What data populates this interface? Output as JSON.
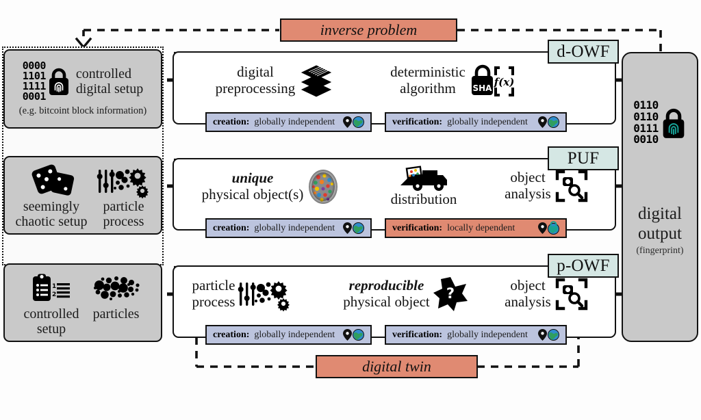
{
  "figure": {
    "title": "Digital and physical one-way function pipelines",
    "colors": {
      "red_label": "#e08a72",
      "blue_badge": "#bcc4de",
      "mint_tag": "#d5e7e4",
      "grey_box": "#c9c9c9",
      "outline": "#111111",
      "fingerprint_teal": "#17a398"
    }
  },
  "feedback": {
    "inverse_problem": "inverse problem",
    "digital_twin": "digital twin"
  },
  "tags": {
    "d_owf": "d-OWF",
    "puf": "PUF",
    "p_owf": "p-OWF"
  },
  "rows": [
    {
      "id": "d-owf",
      "setup": {
        "cells": [
          {
            "icon": "binary-lock-fingerprint-icon",
            "label": "controlled\ndigital setup",
            "line1": "controlled",
            "line2": "digital setup"
          }
        ],
        "binary": [
          "0000",
          "1101",
          "1111",
          "0001"
        ],
        "subtitle": "(e.g. bitcoint block information)"
      },
      "steps": [
        {
          "line1": "digital",
          "line2": "preprocessing",
          "icon": "layers-stack-icon",
          "italic": false
        },
        {
          "line1": "deterministic",
          "line2": "algorithm",
          "icon": "sha-lock-fx-icon",
          "italic": false
        }
      ],
      "badges": [
        {
          "kind": "creation",
          "label": "creation:",
          "value": "globally independent",
          "tone": "blue",
          "icons": [
            "pin-icon",
            "globe-icon"
          ]
        },
        {
          "kind": "verification",
          "label": "verification:",
          "value": "globally independent",
          "tone": "blue",
          "icons": [
            "pin-icon",
            "globe-icon"
          ]
        }
      ],
      "tag": "d-OWF"
    },
    {
      "id": "puf",
      "setup": {
        "cells": [
          {
            "icon": "dice-icon",
            "line1": "seemingly",
            "line2": "chaotic setup"
          },
          {
            "icon": "particle-process-icon",
            "line1": "particle",
            "line2": "process"
          }
        ],
        "subtitle": ""
      },
      "steps": [
        {
          "line1": "unique",
          "line2": "physical object(s)",
          "icon": "colorful-particle-blob-icon",
          "italic": true
        },
        {
          "line1": "",
          "line2": "distribution",
          "icon": "delivery-truck-icon",
          "italic": false
        },
        {
          "line1": "object",
          "line2": "analysis",
          "icon": "object-scan-icon",
          "italic": false
        }
      ],
      "badges": [
        {
          "kind": "creation",
          "label": "creation:",
          "value": "globally independent",
          "tone": "blue",
          "icons": [
            "pin-icon",
            "globe-icon"
          ]
        },
        {
          "kind": "verification",
          "label": "verification:",
          "value": "locally dependent",
          "tone": "red",
          "icons": [
            "pin-icon",
            "globe-lock-icon"
          ]
        }
      ],
      "tag": "PUF"
    },
    {
      "id": "p-owf",
      "setup": {
        "cells": [
          {
            "icon": "clipboard-list-icon",
            "line1": "controlled",
            "line2": "setup"
          },
          {
            "icon": "particles-icon",
            "line1": "particles",
            "line2": ""
          }
        ],
        "subtitle": ""
      },
      "steps": [
        {
          "line1": "particle",
          "line2": "process",
          "icon": "particle-process-icon",
          "italic": false
        },
        {
          "line1": "reproducible",
          "line2": "physical object",
          "icon": "star-question-icon",
          "italic": true
        },
        {
          "line1": "object",
          "line2": "analysis",
          "icon": "object-scan-icon",
          "italic": false
        }
      ],
      "badges": [
        {
          "kind": "creation",
          "label": "creation:",
          "value": "globally independent",
          "tone": "blue",
          "icons": [
            "pin-icon",
            "globe-icon"
          ]
        },
        {
          "kind": "verification",
          "label": "verification:",
          "value": "globally independent",
          "tone": "blue",
          "icons": [
            "pin-icon",
            "globe-icon"
          ]
        }
      ],
      "tag": "p-OWF"
    }
  ],
  "output": {
    "binary": [
      "0110",
      "0110",
      "0111",
      "0010"
    ],
    "icon": "lock-fingerprint-icon",
    "title_line1": "digital",
    "title_line2": "output",
    "subtitle": "(fingerprint)"
  }
}
